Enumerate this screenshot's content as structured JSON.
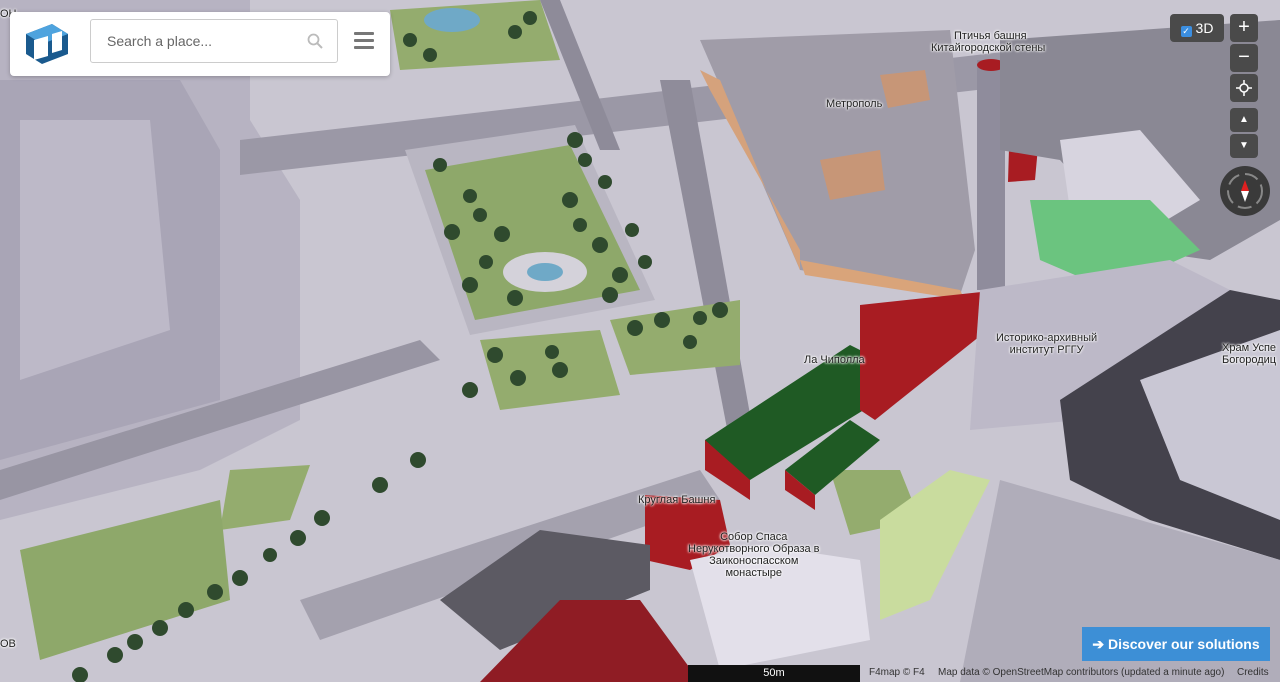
{
  "search": {
    "placeholder": "Search a place..."
  },
  "controls": {
    "toggle_3d_label": "3D",
    "toggle_3d_checked": true,
    "zoom_in": "+",
    "zoom_out": "−"
  },
  "labels": {
    "metropol": "Метрополь",
    "bird_tower_line1": "Птичья башня",
    "bird_tower_line2": "Китайгородской стены",
    "la_cipolla": "Ла Чиполла",
    "institute_line1": "Историко-архивный",
    "institute_line2": "институт РГГУ",
    "round_tower": "Круглая Башня",
    "sobor_line1": "Собор Спаса",
    "sobor_line2": "Нерукотворного Образа в",
    "sobor_line3": "Заиконоспасском",
    "sobor_line4": "монастыре",
    "church_line1": "Храм Успе",
    "church_line2": "Богородиц",
    "left_edge_text": "ОН",
    "left_bottom_text": "ОВ"
  },
  "footer": {
    "discover_label": "Discover our solutions",
    "scale_label": "50m",
    "f4map_credit": "F4map © F4",
    "osm_credit": "Map data © OpenStreetMap contributors (updated a minute ago)",
    "credits_link": "Credits"
  }
}
